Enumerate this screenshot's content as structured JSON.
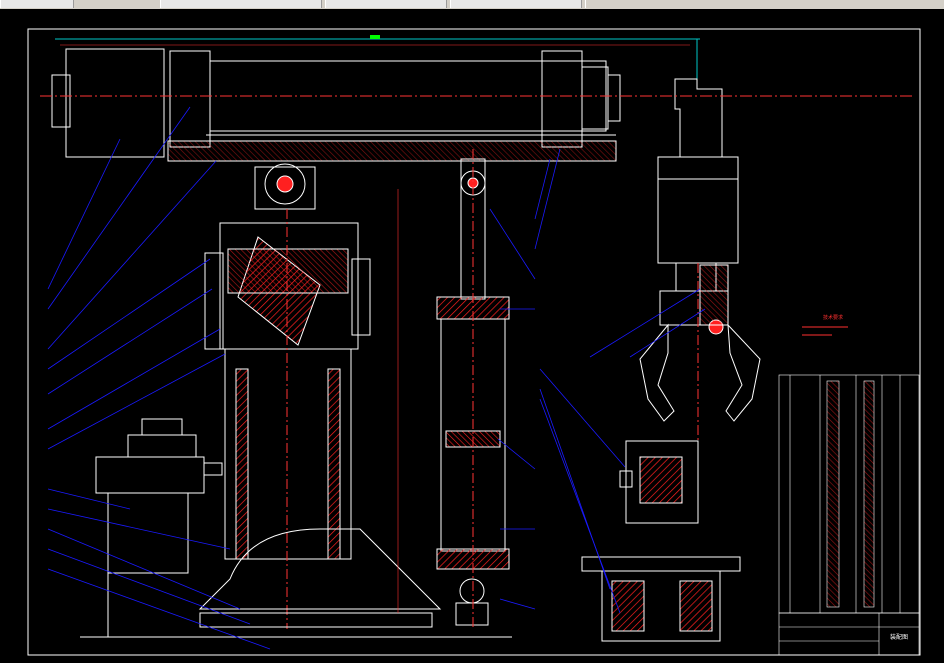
{
  "app": {
    "canvas_background": "#000000",
    "chrome_color": "#d4d0c8"
  },
  "tabs": [
    {
      "label": ""
    },
    {
      "label": ""
    },
    {
      "label": ""
    },
    {
      "label": ""
    },
    {
      "label": ""
    }
  ],
  "colors": {
    "outline": "#ffffff",
    "section": "#ff2020",
    "centerline": "#ff3333",
    "leader": "#1a1aff",
    "dimension": "#ff3030",
    "frame_accent": "#00c8c8",
    "accent_green": "#00ff00"
  },
  "drawing": {
    "title_block_label": "装配图",
    "notes_title": "技术要求"
  }
}
